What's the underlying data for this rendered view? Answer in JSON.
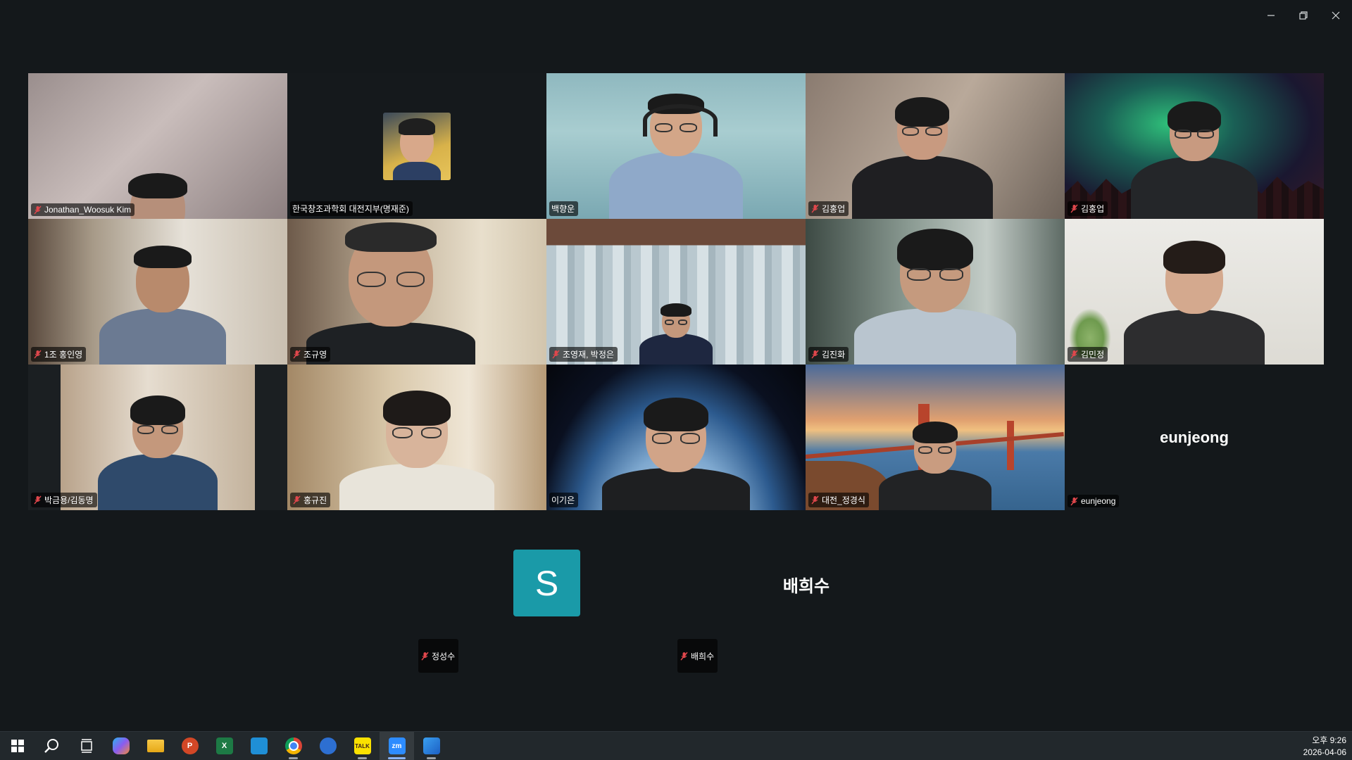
{
  "window": {
    "controls": [
      "minimize-icon",
      "restore-icon",
      "close-icon"
    ]
  },
  "participants": [
    {
      "name": "Jonathan_Woosuk Kim",
      "muted": true
    },
    {
      "name": "한국창조과학회 대전지부(명재준)",
      "muted": false
    },
    {
      "name": "백향운",
      "muted": false,
      "active_speaker": true
    },
    {
      "name": "김홍업",
      "muted": true
    },
    {
      "name": "김홍업",
      "muted": true
    },
    {
      "name": "1조 홍인영",
      "muted": true
    },
    {
      "name": "조규영",
      "muted": true
    },
    {
      "name": "조영재, 박정은",
      "muted": true
    },
    {
      "name": "김진화",
      "muted": true
    },
    {
      "name": "김민정",
      "muted": true
    },
    {
      "name": "박금용/김동명",
      "muted": true
    },
    {
      "name": "홍규진",
      "muted": true
    },
    {
      "name": "이기은",
      "muted": false
    },
    {
      "name": "대전_정경식",
      "muted": true
    },
    {
      "name": "eunjeong",
      "muted": true,
      "video_off": true,
      "display_name": "eunjeong"
    }
  ],
  "bottom_participants": [
    {
      "name": "정성수",
      "muted": true,
      "avatar_letter": "S",
      "avatar_color": "#1a9aa8"
    },
    {
      "name": "배희수",
      "muted": true,
      "display_name": "배희수"
    }
  ],
  "taskbar": {
    "icons": [
      "windows-start-icon",
      "search-icon",
      "task-view-icon",
      "copilot-icon",
      "file-explorer-icon",
      "powerpoint-icon",
      "excel-icon",
      "app-icon",
      "chrome-icon",
      "app-icon",
      "kakaotalk-icon",
      "zoom-icon",
      "app-icon"
    ],
    "kakao_label": "TALK",
    "zoom_label": "zm",
    "excel_label": "X",
    "ppt_label": "P",
    "time": "오후 9:26",
    "date": "2026-04-06"
  },
  "colors": {
    "active_speaker_border": "#2ed47a",
    "background": "#14181b",
    "mute_red": "#e0474c"
  }
}
